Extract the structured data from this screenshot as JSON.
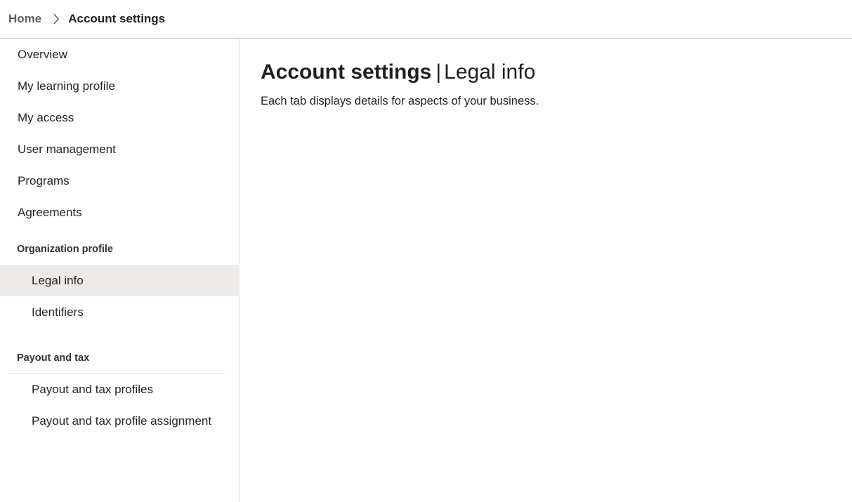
{
  "breadcrumb": {
    "home": "Home",
    "current": "Account settings"
  },
  "sidebar": {
    "items": [
      {
        "label": "Overview"
      },
      {
        "label": "My learning profile"
      },
      {
        "label": "My access"
      },
      {
        "label": "User management"
      },
      {
        "label": "Programs"
      },
      {
        "label": "Agreements"
      }
    ],
    "groups": [
      {
        "header": "Organization profile",
        "items": [
          {
            "label": "Legal info",
            "selected": true
          },
          {
            "label": "Identifiers"
          }
        ]
      },
      {
        "header": "Payout and tax",
        "items": [
          {
            "label": "Payout and tax profiles"
          },
          {
            "label": "Payout and tax profile assignment"
          }
        ]
      }
    ]
  },
  "main": {
    "title_strong": "Account settings",
    "title_separator": "|",
    "title_light": "Legal info",
    "description": "Each tab displays details for aspects of your business."
  },
  "icons": {
    "breadcrumb_separator": "chevron-right-icon"
  },
  "colors": {
    "selected_background": "#edebe9",
    "divider": "#e1dfdd",
    "text": "#1f1f1f",
    "muted_text": "#605e5c"
  }
}
